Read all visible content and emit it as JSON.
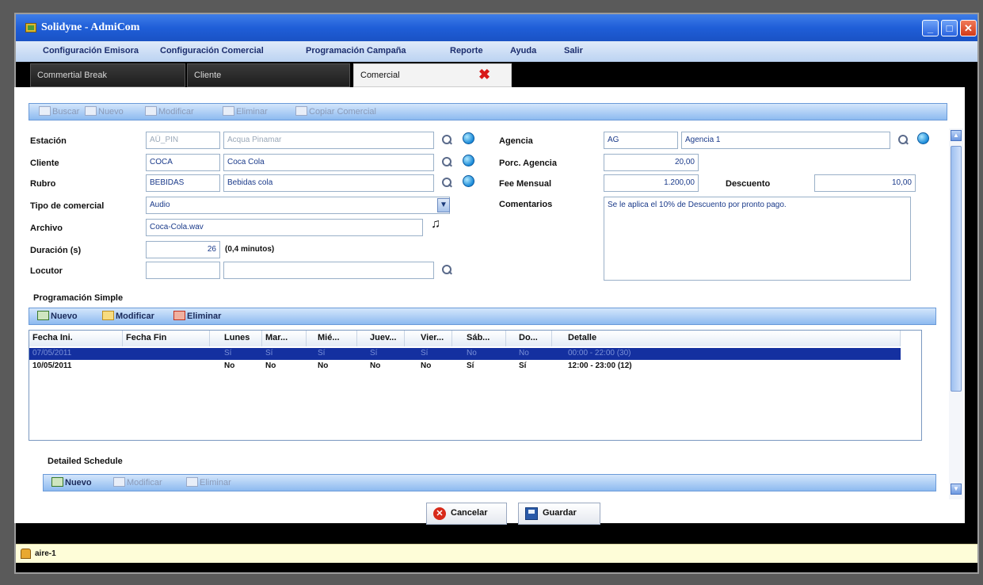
{
  "window": {
    "title": "Solidyne - AdmiCom"
  },
  "menu": [
    "Configuración Emisora",
    "Configuración Comercial",
    "Programación Campaña",
    "Reporte",
    "Ayuda",
    "Salir"
  ],
  "tabs": [
    {
      "label": "Commertial Break"
    },
    {
      "label": "Cliente"
    },
    {
      "label": "Comercial"
    }
  ],
  "toolbar_main": [
    "Buscar",
    "Nuevo",
    "Modificar",
    "Eliminar",
    "Copiar Comercial"
  ],
  "form": {
    "estacion": {
      "label": "Estación",
      "code": "AÜ_PIN",
      "name": "Acqua Pinamar"
    },
    "cliente": {
      "label": "Cliente",
      "code": "COCA",
      "name": "Coca Cola"
    },
    "rubro": {
      "label": "Rubro",
      "code": "BEBIDAS",
      "name": "Bebidas cola"
    },
    "tipo": {
      "label": "Tipo de comercial",
      "value": "Audio"
    },
    "archivo": {
      "label": "Archivo",
      "value": "Coca-Cola.wav"
    },
    "duracion": {
      "label": "Duración (s)",
      "value": "26",
      "note": "(0,4 minutos)"
    },
    "locutor": {
      "label": "Locutor"
    },
    "agencia": {
      "label": "Agencia",
      "code": "AG",
      "name": "Agencia 1"
    },
    "porc_agencia": {
      "label": "Porc. Agencia",
      "value": "20,00"
    },
    "fee": {
      "label": "Fee Mensual",
      "value": "1.200,00"
    },
    "descuento": {
      "label": "Descuento",
      "value": "10,00"
    },
    "comentarios": {
      "label": "Comentarios",
      "value": "Se le aplica el 10% de Descuento por pronto pago."
    }
  },
  "prog_simple": {
    "title": "Programación Simple",
    "toolbar": [
      "Nuevo",
      "Modificar",
      "Eliminar"
    ],
    "columns": [
      "Fecha Ini.",
      "Fecha Fin",
      "Lunes",
      "Mar...",
      "Mié...",
      "Juev...",
      "Vier...",
      "Sáb...",
      "Do...",
      "Detalle"
    ],
    "rows": [
      [
        "07/05/2011",
        "",
        "Sí",
        "Sí",
        "Sí",
        "Sí",
        "Sí",
        "No",
        "No",
        "00:00 - 22:00 (30)"
      ],
      [
        "10/05/2011",
        "",
        "No",
        "No",
        "No",
        "No",
        "No",
        "Sí",
        "Sí",
        "12:00 - 23:00 (12)"
      ]
    ]
  },
  "detailed": {
    "title": "Detailed Schedule",
    "toolbar": [
      "Nuevo",
      "Modificar",
      "Eliminar"
    ]
  },
  "buttons": {
    "cancel": "Cancelar",
    "save": "Guardar"
  },
  "status": {
    "text": "aire-1"
  }
}
